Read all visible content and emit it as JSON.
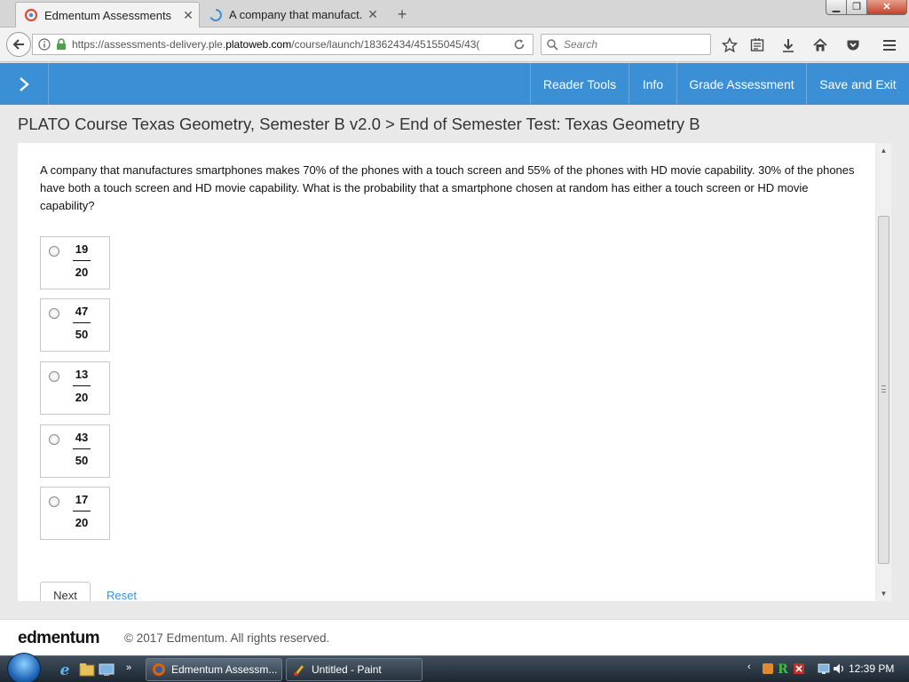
{
  "browser": {
    "tabs": [
      {
        "title": "Edmentum Assessments",
        "active": true,
        "icon": "edmentum-icon"
      },
      {
        "title": "A company that manufact...",
        "active": false,
        "icon": "loading-spinner-icon"
      }
    ],
    "url_prefix": "https://assessments-delivery.ple.",
    "url_domain": "platoweb.com",
    "url_suffix": "/course/launch/18362434/45155045/43(",
    "search_placeholder": "Search"
  },
  "header": {
    "links": [
      "Reader Tools",
      "Info",
      "Grade Assessment",
      "Save and Exit"
    ],
    "accent": "#3b8fd5"
  },
  "page": {
    "breadcrumb": "PLATO Course Texas Geometry, Semester B v2.0 > End of Semester Test: Texas Geometry B",
    "question": "A company that manufactures smartphones makes 70% of the phones with a touch screen and 55% of the phones with HD movie capability. 30% of the phones have both a touch screen and HD movie capability. What is the probability that a smartphone chosen at random has either a touch screen or HD movie capability?",
    "choices": [
      {
        "num": "19",
        "den": "20"
      },
      {
        "num": "47",
        "den": "50"
      },
      {
        "num": "13",
        "den": "20"
      },
      {
        "num": "43",
        "den": "50"
      },
      {
        "num": "17",
        "den": "20"
      }
    ],
    "next_label": "Next",
    "reset_label": "Reset"
  },
  "footer": {
    "logo": "edmentum",
    "copyright": "© 2017 Edmentum. All rights reserved."
  },
  "taskbar": {
    "tasks": [
      "Edmentum Assessm...",
      "Untitled - Paint"
    ],
    "clock": "12:39 PM"
  }
}
